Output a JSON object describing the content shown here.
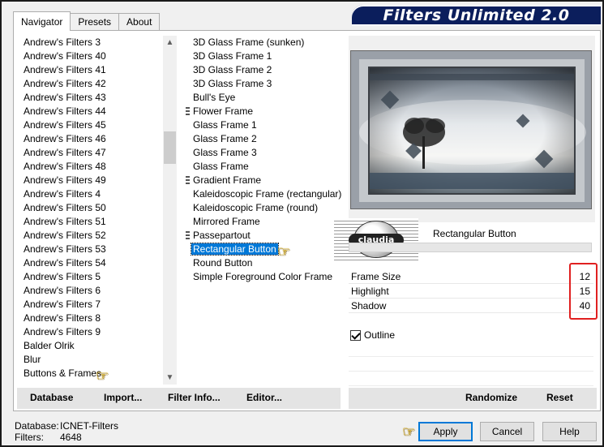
{
  "window": {
    "title": "Filters Unlimited 2.0"
  },
  "tabs": [
    {
      "label": "Navigator",
      "active": true
    },
    {
      "label": "Presets",
      "active": false
    },
    {
      "label": "About",
      "active": false
    }
  ],
  "categories": [
    "Andrew's Filters 3",
    "Andrew's Filters 40",
    "Andrew's Filters 41",
    "Andrew's Filters 42",
    "Andrew's Filters 43",
    "Andrew's Filters 44",
    "Andrew's Filters 45",
    "Andrew's Filters 46",
    "Andrew's Filters 47",
    "Andrew's Filters 48",
    "Andrew's Filters 49",
    "Andrew's Filters 4",
    "Andrew's Filters 50",
    "Andrew's Filters 51",
    "Andrew's Filters 52",
    "Andrew's Filters 53",
    "Andrew's Filters 54",
    "Andrew's Filters 5",
    "Andrew's Filters 6",
    "Andrew's Filters 7",
    "Andrew's Filters 8",
    "Andrew's Filters 9",
    "Balder Olrik",
    "Blur",
    "Buttons & Frames"
  ],
  "filters": [
    {
      "label": "3D Glass Frame (sunken)",
      "grip": false
    },
    {
      "label": "3D Glass Frame 1",
      "grip": false
    },
    {
      "label": "3D Glass Frame 2",
      "grip": false
    },
    {
      "label": "3D Glass Frame 3",
      "grip": false
    },
    {
      "label": "Bull's Eye",
      "grip": false
    },
    {
      "label": "Flower Frame",
      "grip": true
    },
    {
      "label": "Glass Frame 1",
      "grip": false
    },
    {
      "label": "Glass Frame 2",
      "grip": false
    },
    {
      "label": "Glass Frame 3",
      "grip": false
    },
    {
      "label": "Glass Frame",
      "grip": false
    },
    {
      "label": "Gradient Frame",
      "grip": true
    },
    {
      "label": "Kaleidoscopic Frame (rectangular)",
      "grip": false
    },
    {
      "label": "Kaleidoscopic Frame (round)",
      "grip": false
    },
    {
      "label": "Mirrored Frame",
      "grip": false
    },
    {
      "label": "Passepartout",
      "grip": true
    },
    {
      "label": "Rectangular Button",
      "grip": false,
      "selected": true
    },
    {
      "label": "Round Button",
      "grip": false
    },
    {
      "label": "Simple Foreground Color Frame",
      "grip": false
    }
  ],
  "filter_panel": {
    "logo_text": "claudia",
    "selected_filter": "Rectangular Button",
    "params": [
      {
        "name": "Frame Size",
        "value": "12"
      },
      {
        "name": "Highlight",
        "value": "15"
      },
      {
        "name": "Shadow",
        "value": "40"
      }
    ],
    "outline_label": "Outline"
  },
  "left_buttons": {
    "database": "Database",
    "import": "Import...",
    "filter_info": "Filter Info...",
    "editor": "Editor..."
  },
  "right_buttons": {
    "randomize": "Randomize",
    "reset": "Reset"
  },
  "status": {
    "database_label": "Database:",
    "database_value": "ICNET-Filters",
    "filters_label": "Filters:",
    "filters_value": "4648"
  },
  "dialog_buttons": {
    "apply": "Apply",
    "cancel": "Cancel",
    "help": "Help"
  },
  "colors": {
    "title_bg": "#0b1e5c",
    "selection": "#0078d7",
    "highlight_box": "#e02020",
    "pointer_hand": "#f3c200"
  }
}
